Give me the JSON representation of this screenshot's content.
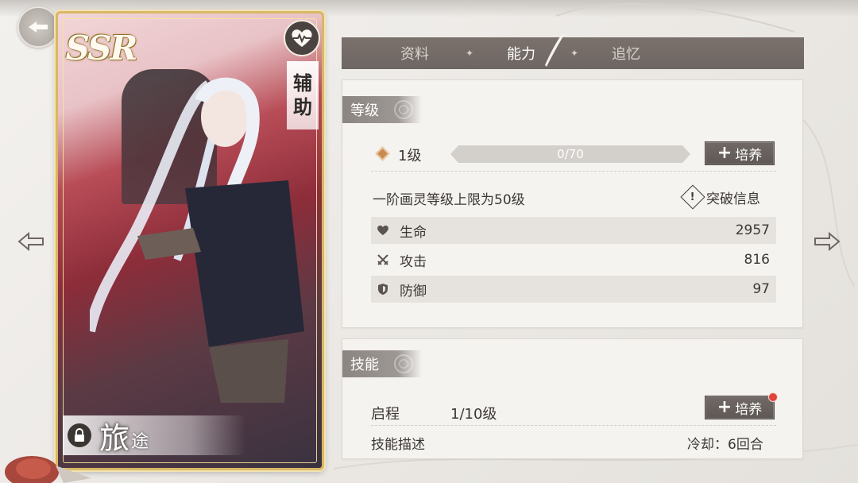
{
  "colors": {
    "tab_bar": "#6e6662",
    "panel_bg": "#f5f3f0",
    "accent_gold": "#d8b866",
    "button": "#5f5854",
    "notification": "#e0443a"
  },
  "card": {
    "rarity": "SSR",
    "role_icon": "heartbeat-icon",
    "role": [
      "辅",
      "助"
    ],
    "name_main": "旅",
    "name_sub": "途",
    "locked": true
  },
  "tabs": [
    {
      "label": "资料",
      "active": false
    },
    {
      "label": "能力",
      "active": true
    },
    {
      "label": "追忆",
      "active": false
    }
  ],
  "level_panel": {
    "title": "等级",
    "level": "1级",
    "exp_text": "0/70",
    "exp_progress": 0,
    "train_label": "培养",
    "cap_text": "一阶画灵等级上限为50级",
    "break_label": "突破信息",
    "stats": [
      {
        "icon": "heart-icon",
        "label": "生命",
        "value": "2957"
      },
      {
        "icon": "crossed-swords-icon",
        "label": "攻击",
        "value": "816"
      },
      {
        "icon": "shield-icon",
        "label": "防御",
        "value": "97"
      }
    ]
  },
  "skill_panel": {
    "title": "技能",
    "skill_name": "启程",
    "skill_level": "1/10级",
    "train_label": "培养",
    "has_notification": true,
    "desc_label": "技能描述",
    "cooldown": "冷却：6回合"
  }
}
